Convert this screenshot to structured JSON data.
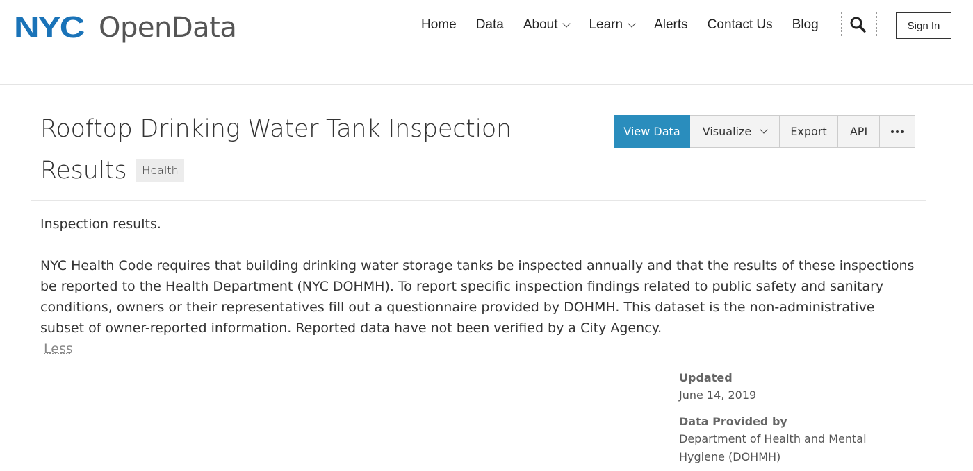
{
  "header": {
    "logo": {
      "nyc": "NYC",
      "text": "OpenData"
    },
    "nav": [
      {
        "label": "Home"
      },
      {
        "label": "Data"
      },
      {
        "label": "About"
      },
      {
        "label": "Learn"
      },
      {
        "label": "Alerts"
      },
      {
        "label": "Contact Us"
      },
      {
        "label": "Blog"
      }
    ],
    "sign_in": "Sign In"
  },
  "dataset": {
    "title_line1": "Rooftop Drinking Water Tank Inspection",
    "title_line2": "Results",
    "tag": "Health",
    "actions": {
      "view_data": "View Data",
      "visualize": "Visualize",
      "export": "Export",
      "api": "API"
    },
    "description_short": "Inspection results.",
    "description_long": "NYC Health Code requires that building drinking water storage tanks be inspected annually and that the results of these inspections be reported to the Health Department (NYC DOHMH). To report specific inspection findings related to public safety and sanitary conditions, owners or their representatives fill out a questionnaire provided by DOHMH. This dataset is the non-administrative subset of owner-reported information. Reported data have not been verified by a City Agency.",
    "less_link": "Less"
  },
  "metadata": {
    "updated_label": "Updated",
    "updated_value": "June 14, 2019",
    "provider_label": "Data Provided by",
    "provider_value": "Department of Health and Mental Hygiene (DOHMH)"
  },
  "colors": {
    "primary_button": "#2a8dbd",
    "logo_blue": "#1a73b8"
  },
  "icons": [
    "search-icon",
    "chevron-down-icon",
    "more-icon"
  ]
}
